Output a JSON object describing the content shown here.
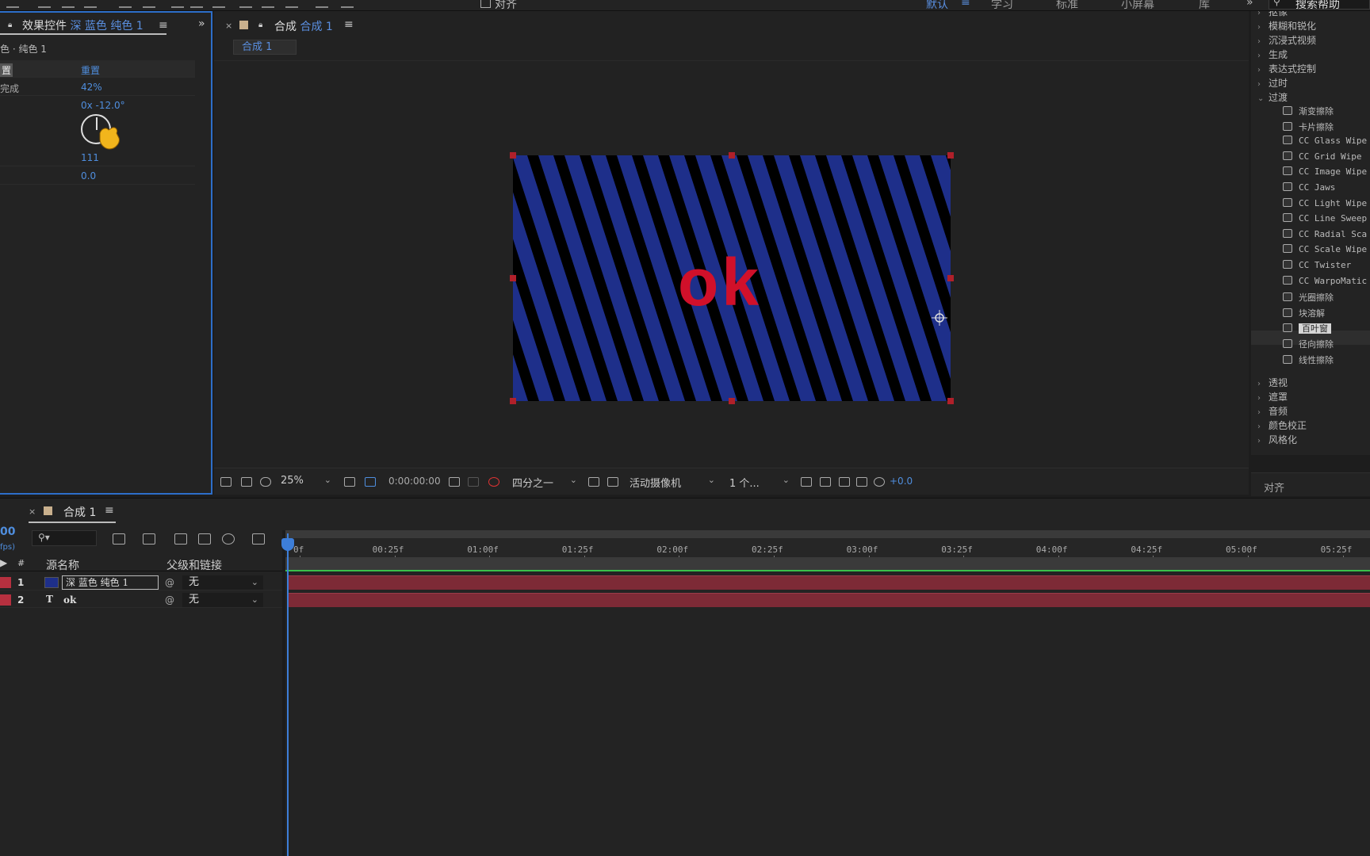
{
  "toolbar": {
    "align_label": "对齐",
    "workspaces": [
      "默认",
      "学习",
      "标准",
      "小屏幕",
      "库"
    ],
    "search_label": "搜索帮助"
  },
  "effect_controls": {
    "tab_prefix": "效果控件",
    "tab_layer": "深 蓝色 纯色 1",
    "layer_path": "色 · 纯色 1",
    "rows": [
      {
        "label": "置",
        "value": "重置"
      },
      {
        "label": "完成",
        "value": "42%"
      },
      {
        "label": "",
        "value": "0x -12.0°"
      },
      {
        "label": "",
        "value": "111"
      },
      {
        "label": "",
        "value": "0.0"
      }
    ]
  },
  "composition": {
    "tab_prefix": "合成",
    "tab_name": "合成 1",
    "breadcrumb": "合成 1",
    "canvas_text": "ok",
    "stripe_color": "#1e2f8a",
    "text_color": "#d1102a",
    "viewer_bar": {
      "zoom": "25%",
      "time": "0:00:00:00",
      "resolution": "四分之一",
      "camera": "活动摄像机",
      "views": "1 个...",
      "exposure": "+0.0"
    }
  },
  "effects_presets": {
    "categories_top": [
      "模糊和锐化",
      "沉浸式视频",
      "生成",
      "表达式控制",
      "过时"
    ],
    "open_category": "过渡",
    "items": [
      "渐变擦除",
      "卡片擦除",
      "CC Glass Wipe",
      "CC Grid Wipe",
      "CC Image Wipe",
      "CC Jaws",
      "CC Light Wipe",
      "CC Line Sweep",
      "CC Radial Sca",
      "CC Scale Wipe",
      "CC Twister",
      "CC WarpoMatic",
      "光圈擦除",
      "块溶解",
      "百叶窗",
      "径向擦除",
      "线性擦除"
    ],
    "selected_item": "百叶窗",
    "categories_bottom": [
      "透视",
      "遮罩",
      "音频",
      "颜色校正",
      "风格化"
    ],
    "align_title": "对齐"
  },
  "timeline": {
    "tab_name": "合成 1",
    "timecode": "00",
    "fps": "fps)",
    "headers": {
      "num": "#",
      "source": "源名称",
      "parent": "父级和链接"
    },
    "layers": [
      {
        "num": "1",
        "name": "深 蓝色 纯色 1",
        "parent": "无"
      },
      {
        "num": "2",
        "type": "T",
        "name": "ok",
        "parent": "无"
      }
    ],
    "ruler": [
      "0f",
      "00:25f",
      "01:00f",
      "01:25f",
      "02:00f",
      "02:25f",
      "03:00f",
      "03:25f",
      "04:00f",
      "04:25f",
      "05:00f",
      "05:25f"
    ]
  }
}
